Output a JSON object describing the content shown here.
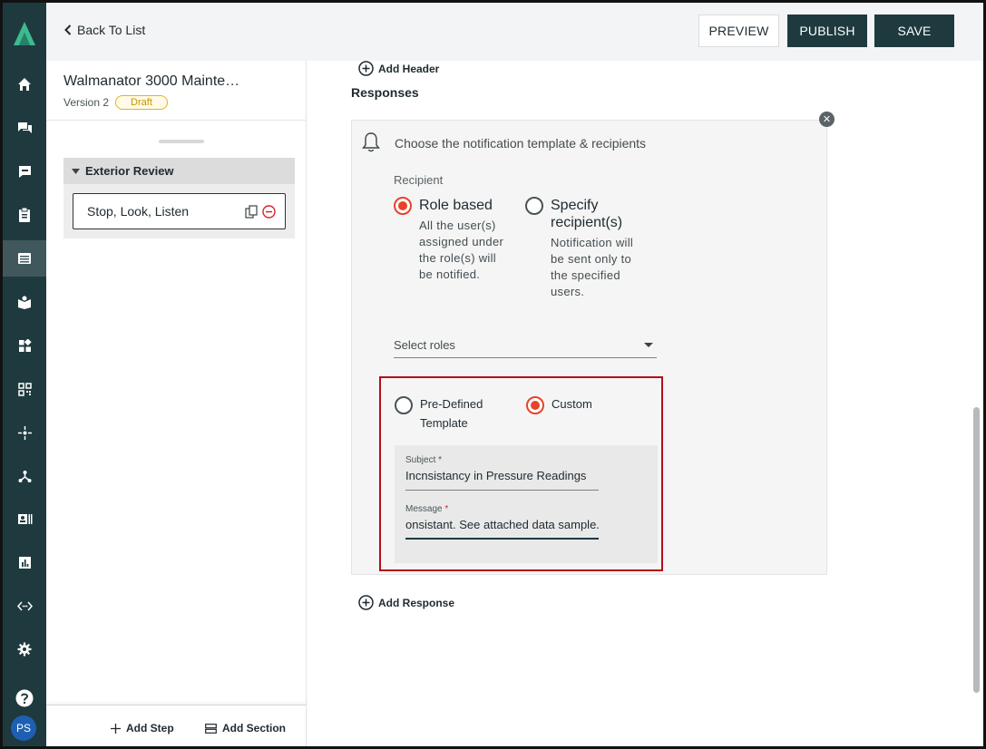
{
  "rail": {
    "items": [
      "home",
      "chat",
      "comments",
      "clipboard",
      "template",
      "book",
      "dashboard",
      "qr-code",
      "sparkle",
      "hierarchy",
      "id-card",
      "report",
      "code",
      "settings",
      "help"
    ],
    "active": "template",
    "avatar_initials": "PS"
  },
  "topbar": {
    "back_label": "Back To List",
    "preview_label": "PREVIEW",
    "publish_label": "PUBLISH",
    "save_label": "SAVE"
  },
  "panel": {
    "title": "Walmanator 3000 Mainte…",
    "version": "Version 2",
    "status": "Draft",
    "section_name": "Exterior Review",
    "step_name": "Stop, Look, Listen",
    "add_step_label": "Add Step",
    "add_section_label": "Add Section"
  },
  "main": {
    "add_header_label": "Add Header",
    "responses_title": "Responses",
    "add_response_label": "Add Response",
    "card": {
      "heading": "Choose the notification template & recipients",
      "recipient_label": "Recipient",
      "role_based": {
        "title": "Role based",
        "desc_lines": [
          "All the user(s)",
          "assigned under",
          "the role(s) will",
          "be notified."
        ],
        "selected": true
      },
      "specify": {
        "title_lines": [
          "Specify",
          "recipient(s)"
        ],
        "desc_lines": [
          "Notification will",
          "be sent only to",
          "the specified",
          "users."
        ],
        "selected": false
      },
      "select_placeholder": "Select roles",
      "template": {
        "predefined_lines": [
          "Pre-Defined",
          "Template"
        ],
        "custom_label": "Custom",
        "selected": "custom",
        "subject_label": "Subject",
        "subject_value": "Incnsistancy in Pressure Readings",
        "message_label": "Message",
        "message_value": "onsistant. See attached data sample."
      }
    }
  },
  "colors": {
    "brand_dark": "#1e3a3f",
    "radio_on": "#e8432a",
    "highlight": "#b30d1a",
    "draft_badge": "#e3b318"
  }
}
